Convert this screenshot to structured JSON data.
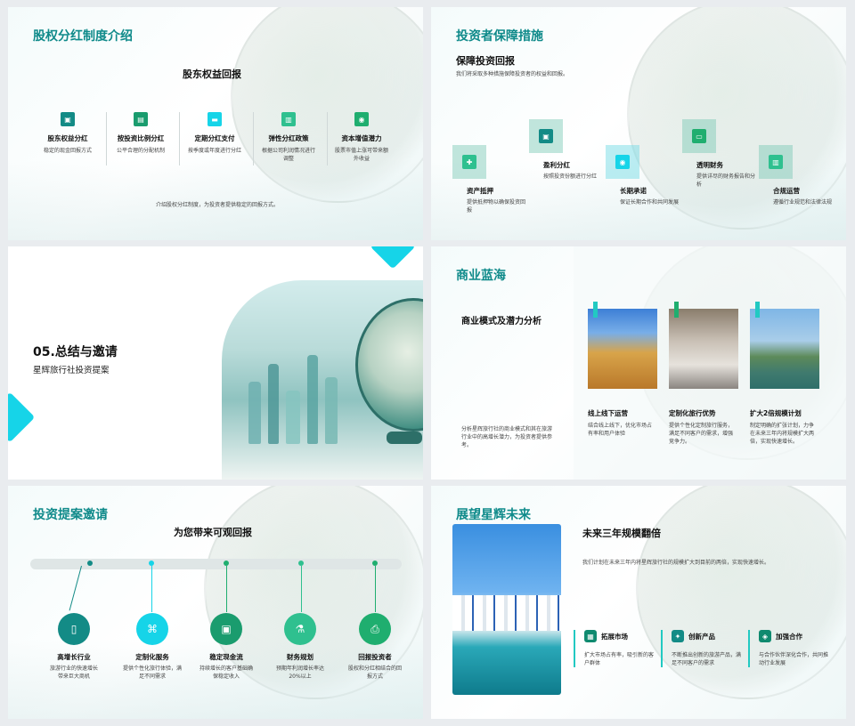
{
  "colors": {
    "accent": "#0f8a8a",
    "teal": "#22c9c2",
    "green": "#1fae6f",
    "cyan": "#16d4e8"
  },
  "slide1": {
    "title": "股权分红制度介绍",
    "subtitle": "股东权益回报",
    "items": [
      {
        "icon": "image-icon",
        "title": "股东权益分红",
        "desc": "稳定的现金回报方式"
      },
      {
        "icon": "wallet-icon",
        "title": "按投资比例分红",
        "desc": "公平合理的分配机制"
      },
      {
        "icon": "card-icon",
        "title": "定期分红支付",
        "desc": "按季度或年度进行分红"
      },
      {
        "icon": "chart-icon",
        "title": "弹性分红政策",
        "desc": "根据公司利润情况进行调整"
      },
      {
        "icon": "location-icon",
        "title": "资本增值潜力",
        "desc": "股票市值上涨可带来额外收益"
      }
    ],
    "footer": "介绍股权分红制度，为投资者提供稳定的回报方式。"
  },
  "slide2": {
    "title": "投资者保障措施",
    "subtitle": "保障投资回报",
    "intro": "我们将采取多种措施保障投资者的权益和回报。",
    "items": [
      {
        "icon": "puzzle-icon",
        "title": "资产抵押",
        "desc": "提供抵押物以确保投资回报"
      },
      {
        "icon": "image-icon",
        "title": "盈利分红",
        "desc": "按照投资份额进行分红"
      },
      {
        "icon": "location-icon",
        "title": "长期承诺",
        "desc": "保证长期合作和共同发展"
      },
      {
        "icon": "car-icon",
        "title": "透明财务",
        "desc": "提供详尽的财务报告和分析"
      },
      {
        "icon": "chart-icon",
        "title": "合规运营",
        "desc": "遵循行业规范和法律法规"
      }
    ]
  },
  "slide3": {
    "title": "05.总结与邀请",
    "subtitle": "星辉旅行社投资提案"
  },
  "slide4": {
    "title": "商业蓝海",
    "subtitle": "商业模式及潜力分析",
    "intro": "分析星辉旅行社的商业模式和其在旅游行业中的高增长潜力，为投资者提供参考。",
    "items": [
      {
        "title": "线上线下运营",
        "desc": "结合线上线下，优化市场占有率和用户体验"
      },
      {
        "title": "定制化旅行优势",
        "desc": "提供个性化定制旅行服务，满足不同客户的需求，增强竞争力。"
      },
      {
        "title": "扩大2倍规模计划",
        "desc": "制定明确的扩张计划，力争在未来三年内将规模扩大两倍，实现快速增长。"
      }
    ]
  },
  "slide5": {
    "title": "投资提案邀请",
    "subtitle": "为您带来可观回报",
    "items": [
      {
        "icon": "document-icon",
        "title": "高增长行业",
        "desc": "旅游行业的快速增长带来巨大商机"
      },
      {
        "icon": "network-icon",
        "title": "定制化服务",
        "desc": "提供个性化旅行体验，满足不同需求"
      },
      {
        "icon": "picture-icon",
        "title": "稳定现金流",
        "desc": "持续增长的客户基础确保稳定收入"
      },
      {
        "icon": "flask-icon",
        "title": "财务规划",
        "desc": "预期年利润增长率达20%以上"
      },
      {
        "icon": "printer-icon",
        "title": "回报投资者",
        "desc": "股权和分红相结合的回报方式"
      }
    ]
  },
  "slide6": {
    "title": "展望星辉未来",
    "subtitle": "未来三年规模翻倍",
    "intro": "我们计划在未来三年内将星辉旅行社的规模扩大到目前的两倍，实现快速增长。",
    "items": [
      {
        "icon": "map-icon",
        "title": "拓展市场",
        "desc": "扩大市场占有率，吸引新的客户群体"
      },
      {
        "icon": "bulb-icon",
        "title": "创新产品",
        "desc": "不断推出创新的旅游产品，满足不同客户的需求"
      },
      {
        "icon": "handshake-icon",
        "title": "加强合作",
        "desc": "与合作伙伴深化合作，共同推动行业发展"
      }
    ]
  }
}
